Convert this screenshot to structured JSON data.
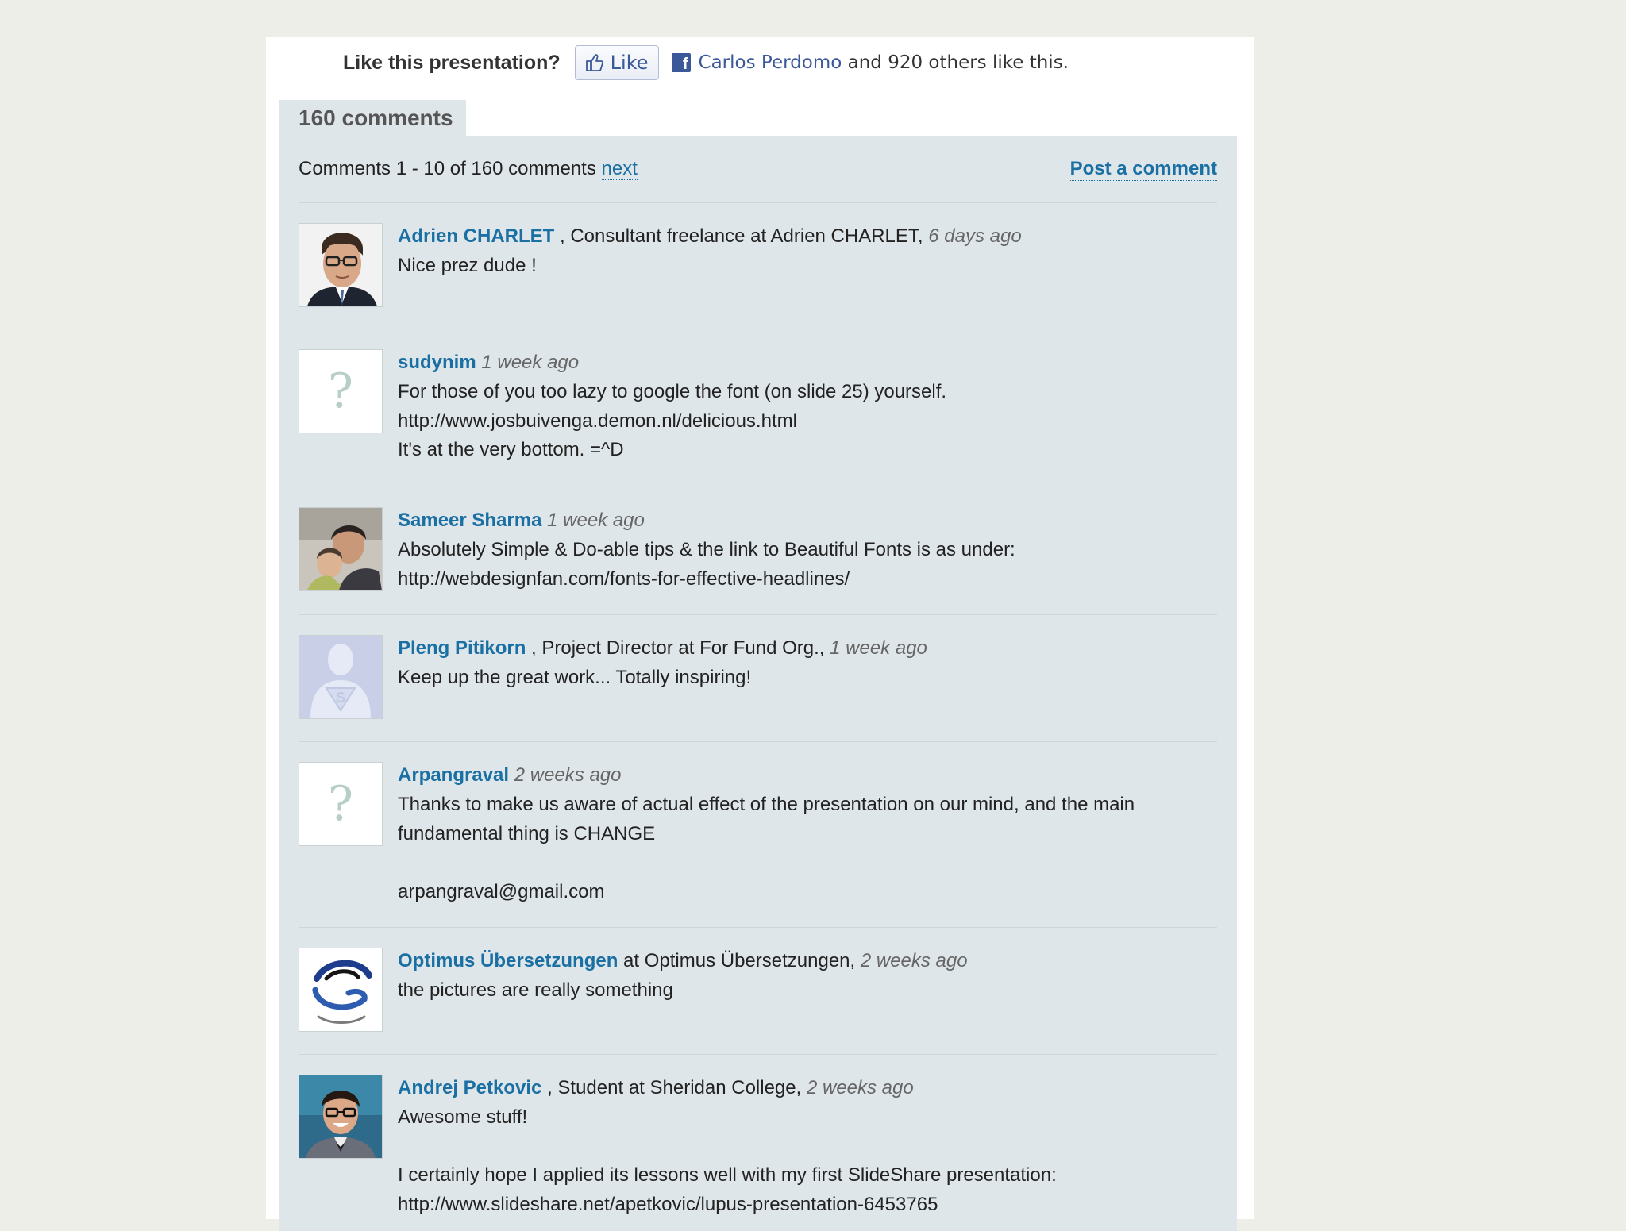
{
  "like_bar": {
    "question": "Like this presentation?",
    "button_label": "Like",
    "friend_name": "Carlos Perdomo",
    "friend_suffix": " and 920 others like this."
  },
  "comments_tab": {
    "label": "160 comments"
  },
  "header": {
    "range_text": "Comments 1 - 10 of 160 comments ",
    "next_label": "next",
    "post_label": "Post a comment"
  },
  "comments": [
    {
      "name": "Adrien CHARLET",
      "role": " , Consultant freelance at Adrien CHARLET, ",
      "time": "6 days ago",
      "text": "Nice prez dude !",
      "avatar": "photo-man-glasses-icon"
    },
    {
      "name": "sudynim",
      "role": " ",
      "time": "1 week ago",
      "text": "For those of you too lazy to google the font (on slide 25) yourself.\nhttp://www.josbuivenga.demon.nl/delicious.html\nIt's at the very bottom. =^D",
      "avatar": "question-mark-icon"
    },
    {
      "name": "Sameer Sharma",
      "role": " ",
      "time": "1 week ago",
      "text": "Absolutely Simple & Do-able tips & the link to Beautiful Fonts is as under:\nhttp://webdesignfan.com/fonts-for-effective-headlines/",
      "avatar": "photo-two-people-icon"
    },
    {
      "name": "Pleng Pitikorn",
      "role": " , Project Director at For Fund Org., ",
      "time": "1 week ago",
      "text": "Keep up the great work... Totally inspiring!",
      "avatar": "superhero-silhouette-icon"
    },
    {
      "name": "Arpangraval",
      "role": " ",
      "time": "2 weeks ago",
      "text": "Thanks to make us aware of actual effect of the presentation on our mind, and the main\nfundamental thing is CHANGE\n\narpangraval@gmail.com",
      "avatar": "question-mark-icon"
    },
    {
      "name": "Optimus Übersetzungen",
      "role": " at Optimus Übersetzungen, ",
      "time": "2 weeks ago",
      "text": "the pictures are really something",
      "avatar": "swirl-logo-icon"
    },
    {
      "name": "Andrej Petkovic",
      "role": " , Student at Sheridan College, ",
      "time": "2 weeks ago",
      "text": "Awesome stuff!\n\nI certainly hope I applied its lessons well with my first SlideShare presentation:\nhttp://www.slideshare.net/apetkovic/lupus-presentation-6453765",
      "avatar": "photo-smiling-man-icon"
    }
  ]
}
